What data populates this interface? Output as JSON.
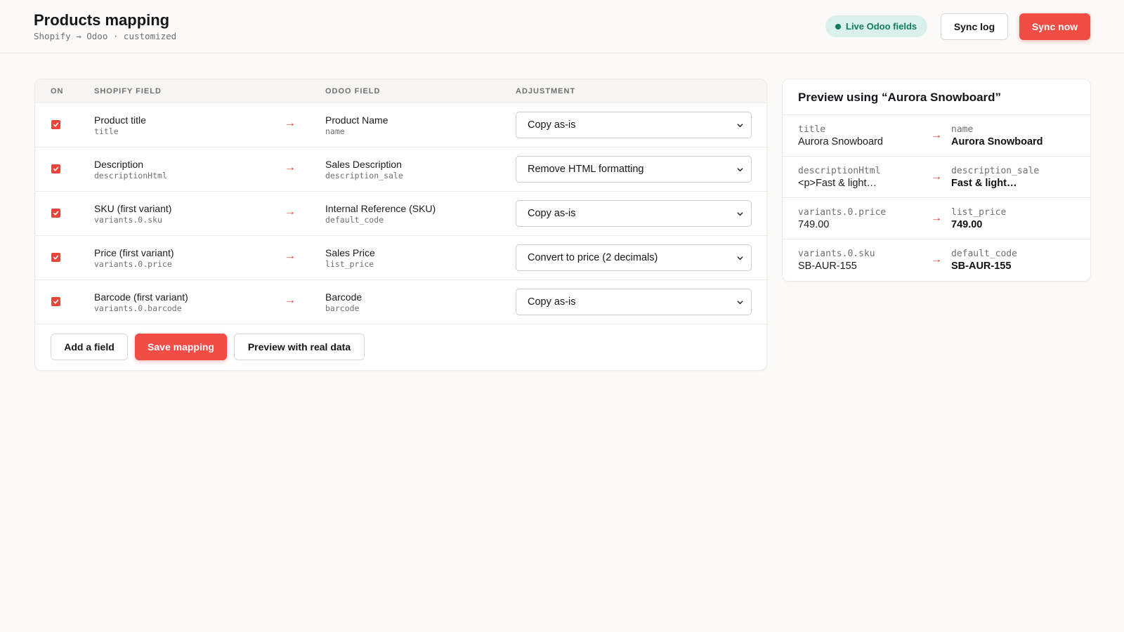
{
  "header": {
    "title": "Products mapping",
    "subtitle": "Shopify → Odoo · customized",
    "live_label": "Live Odoo fields",
    "sync_log_label": "Sync log",
    "sync_now_label": "Sync now"
  },
  "colors": {
    "accent": "#f14d45",
    "live_bg": "#d9f1ea",
    "live_text": "#127a5f"
  },
  "mapping": {
    "columns": {
      "on": "ON",
      "shopify": "SHOPIFY FIELD",
      "odoo": "ODOO FIELD",
      "adjustment": "ADJUSTMENT"
    },
    "rows": [
      {
        "enabled": true,
        "shopify_label": "Product title",
        "shopify_key": "title",
        "arrow": "→",
        "odoo_label": "Product Name",
        "odoo_key": "name",
        "adjustment": "Copy as-is"
      },
      {
        "enabled": true,
        "shopify_label": "Description",
        "shopify_key": "descriptionHtml",
        "arrow": "→",
        "odoo_label": "Sales Description",
        "odoo_key": "description_sale",
        "adjustment": "Remove HTML formatting"
      },
      {
        "enabled": true,
        "shopify_label": "SKU (first variant)",
        "shopify_key": "variants.0.sku",
        "arrow": "→",
        "odoo_label": "Internal Reference (SKU)",
        "odoo_key": "default_code",
        "adjustment": "Copy as-is"
      },
      {
        "enabled": true,
        "shopify_label": "Price (first variant)",
        "shopify_key": "variants.0.price",
        "arrow": "→",
        "odoo_label": "Sales Price",
        "odoo_key": "list_price",
        "adjustment": "Convert to price (2 decimals)"
      },
      {
        "enabled": true,
        "shopify_label": "Barcode (first variant)",
        "shopify_key": "variants.0.barcode",
        "arrow": "→",
        "odoo_label": "Barcode",
        "odoo_key": "barcode",
        "adjustment": "Copy as-is"
      }
    ],
    "actions": {
      "add_field": "Add a field",
      "save": "Save mapping",
      "preview": "Preview with real data"
    }
  },
  "preview": {
    "title": "Preview using “Aurora Snowboard”",
    "rows": [
      {
        "source_key": "title",
        "source_value": "Aurora Snowboard",
        "arrow": "→",
        "target_key": "name",
        "target_value": "Aurora Snowboard"
      },
      {
        "source_key": "descriptionHtml",
        "source_value": "<p>Fast & light…",
        "arrow": "→",
        "target_key": "description_sale",
        "target_value": "Fast & light…"
      },
      {
        "source_key": "variants.0.price",
        "source_value": "749.00",
        "arrow": "→",
        "target_key": "list_price",
        "target_value": "749.00"
      },
      {
        "source_key": "variants.0.sku",
        "source_value": "SB-AUR-155",
        "arrow": "→",
        "target_key": "default_code",
        "target_value": "SB-AUR-155"
      }
    ]
  }
}
